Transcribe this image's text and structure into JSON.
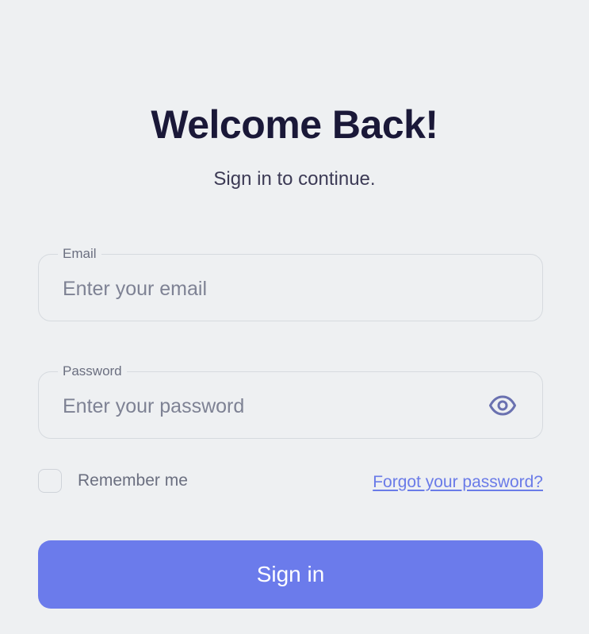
{
  "header": {
    "title": "Welcome Back!",
    "subtitle": "Sign in to continue."
  },
  "form": {
    "email": {
      "label": "Email",
      "placeholder": "Enter your email",
      "value": ""
    },
    "password": {
      "label": "Password",
      "placeholder": "Enter your password",
      "value": "",
      "toggle_icon": "eye-icon"
    },
    "remember_me": {
      "label": "Remember me",
      "checked": false
    },
    "forgot_password_link": "Forgot your password?",
    "submit_label": "Sign in"
  },
  "colors": {
    "background": "#eef0f2",
    "heading": "#1a1838",
    "accent": "#6b7beb",
    "link": "#6a7be8",
    "muted_text": "#6b6f80",
    "border": "#d6dadf"
  }
}
